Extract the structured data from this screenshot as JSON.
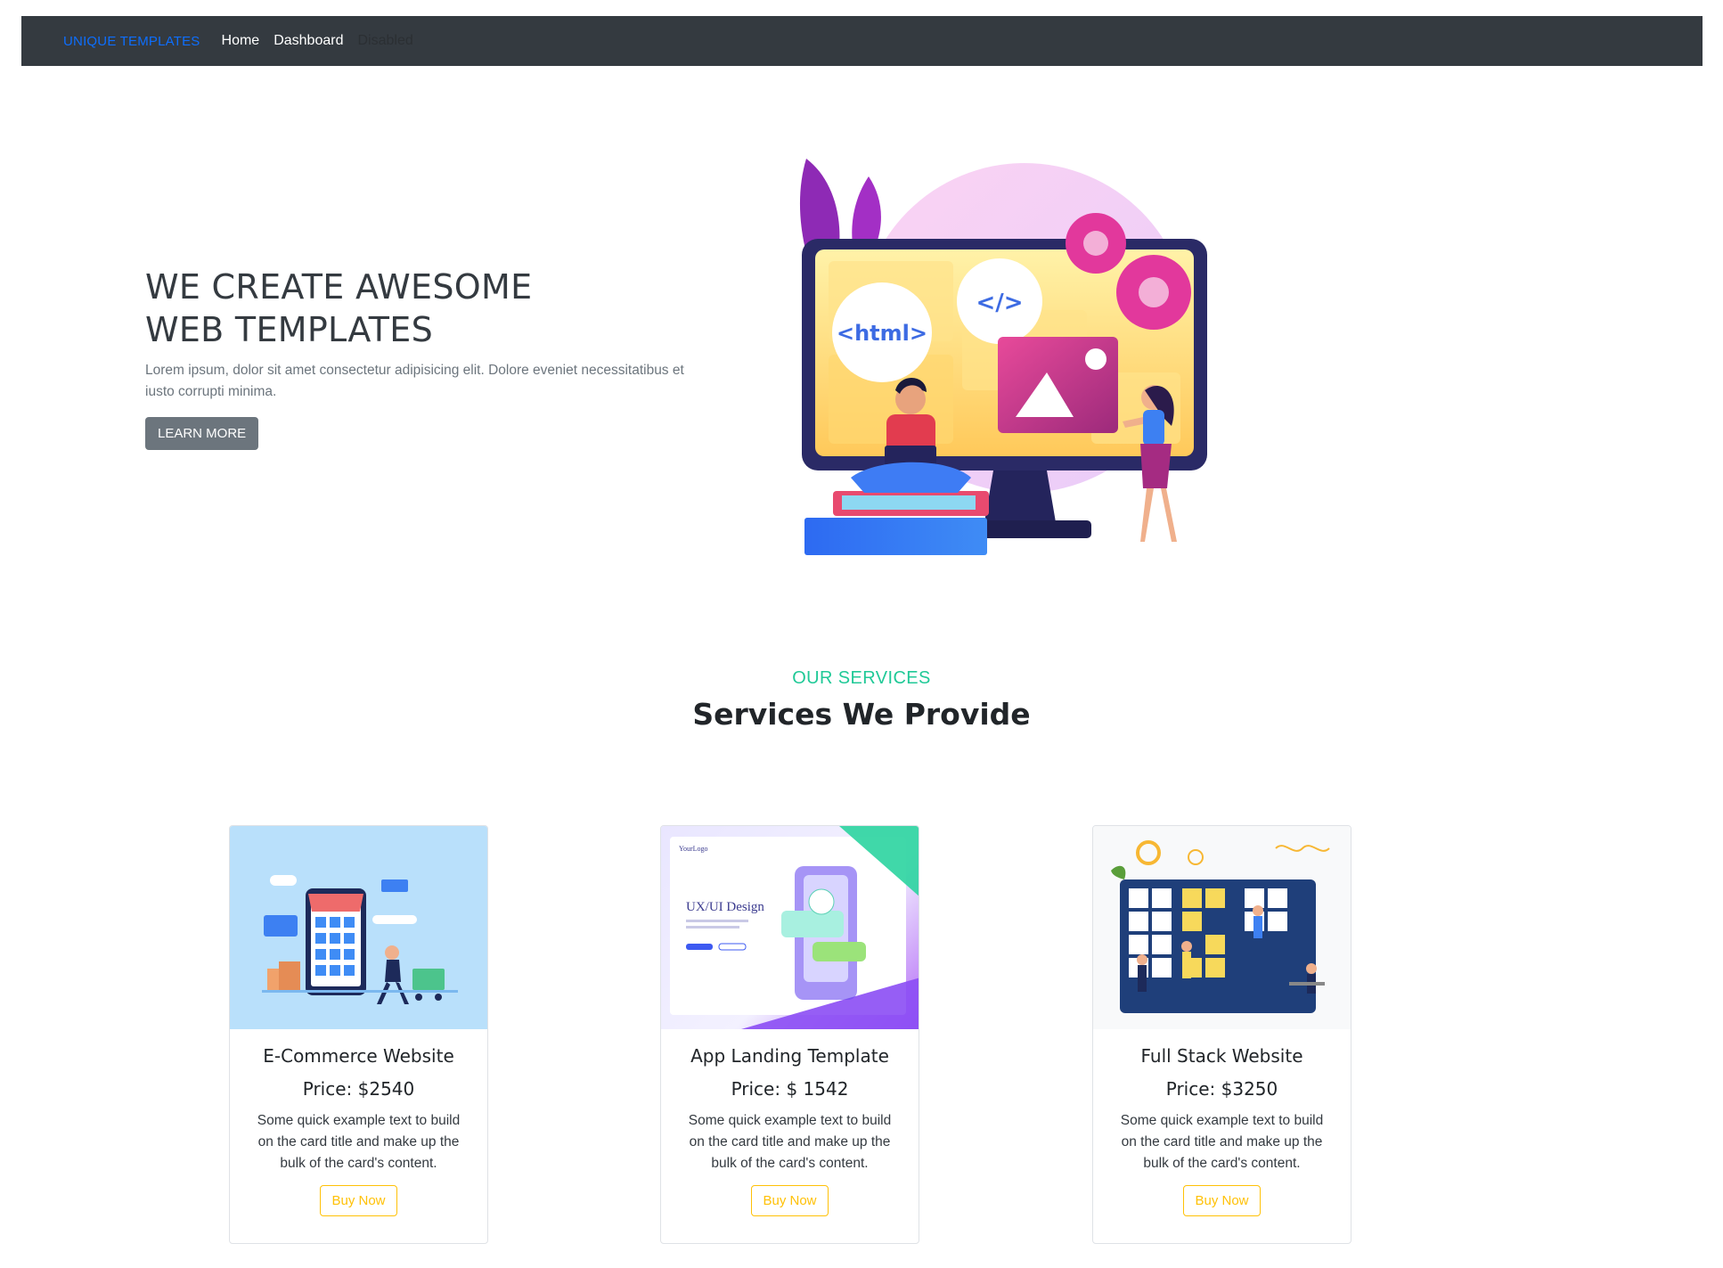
{
  "navbar": {
    "brand": "UNIQUE TEMPLATES",
    "links": [
      {
        "label": "Home"
      },
      {
        "label": "Dashboard"
      },
      {
        "label": "Disabled"
      }
    ]
  },
  "hero": {
    "title_line1": "WE CREATE AWESOME",
    "title_line2": "WEB TEMPLATES",
    "description": "Lorem ipsum, dolor sit amet consectetur adipisicing elit. Dolore eveniet necessitatibus et iusto corrupti minima.",
    "button_label": "LEARN MORE",
    "illustration": {
      "html_bubble": "<html>",
      "code_bubble": "</>"
    }
  },
  "services": {
    "eyebrow": "OUR SERVICES",
    "title": "Services We Provide",
    "cards": [
      {
        "title": "E-Commerce Website",
        "price": "Price: $2540",
        "text": "Some quick example text to build on the card title and make up the bulk of the card's content.",
        "button": "Buy Now"
      },
      {
        "title": "App Landing Template",
        "price": "Price: $ 1542",
        "text": "Some quick example text to build on the card title and make up the bulk of the card's content.",
        "button": "Buy Now",
        "image_text": {
          "logo": "YourLogo",
          "heading": "UX/UI Design"
        }
      },
      {
        "title": "Full Stack Website",
        "price": "Price: $3250",
        "text": "Some quick example text to build on the card title and make up the bulk of the card's content.",
        "button": "Buy Now"
      }
    ]
  },
  "colors": {
    "navbar_bg": "#343a40",
    "brand": "#0d6efd",
    "eyebrow": "#20c997",
    "buy_button": "#ffc107",
    "learn_button": "#6c757d"
  }
}
